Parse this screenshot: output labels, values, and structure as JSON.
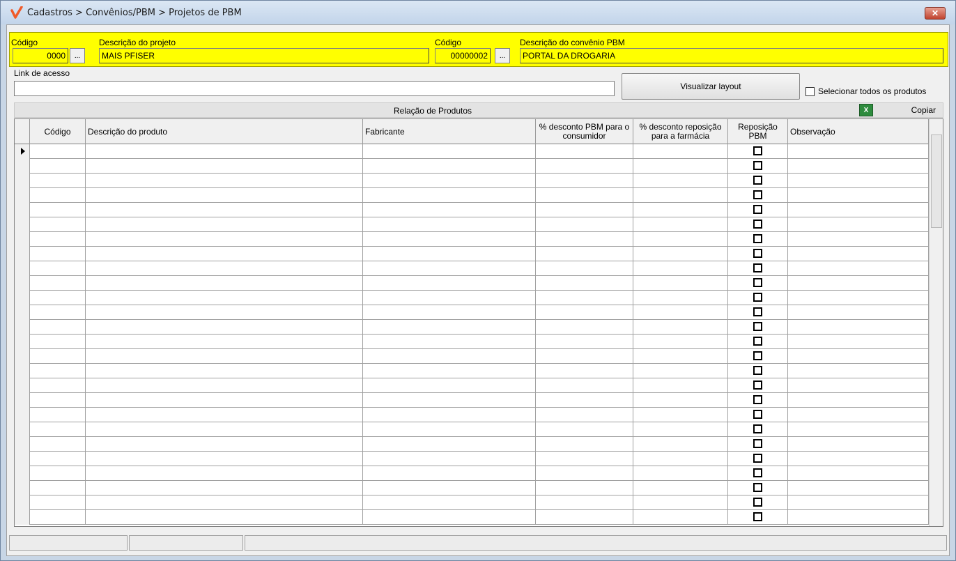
{
  "window": {
    "title": "Cadastros > Convênios/PBM > Projetos de PBM",
    "close_label": "✕"
  },
  "header": {
    "codigo_label": "Código",
    "codigo_value": "0000",
    "descricao_projeto_label": "Descrição do projeto",
    "descricao_projeto_value": "MAIS PFISER",
    "codigo_convenio_label": "Código",
    "codigo_convenio_value": "00000002",
    "descricao_convenio_label": "Descrição do convênio PBM",
    "descricao_convenio_value": "PORTAL DA DROGARIA",
    "lookup_button_label": "..."
  },
  "link": {
    "label": "Link de acesso",
    "value": ""
  },
  "actions": {
    "visualizar_layout": "Visualizar layout",
    "selecionar_todos": "Selecionar todos os produtos"
  },
  "products": {
    "section_title": "Relação de Produtos",
    "copy_label": "Copiar",
    "excel_icon": "excel-icon",
    "columns": [
      {
        "key": "codigo",
        "label": "Código"
      },
      {
        "key": "descricao",
        "label": "Descrição do produto"
      },
      {
        "key": "fabricante",
        "label": "Fabricante"
      },
      {
        "key": "desc_pbm",
        "label": "% desconto PBM para o consumidor"
      },
      {
        "key": "desc_reposicao",
        "label": "% desconto reposição para a farmácia"
      },
      {
        "key": "reposicao_pbm",
        "label": "Reposição PBM"
      },
      {
        "key": "observacao",
        "label": "Observação"
      }
    ],
    "empty_row_count": 26
  },
  "colors": {
    "highlight": "#ffff00",
    "window_bg": "#f0f0f0"
  }
}
